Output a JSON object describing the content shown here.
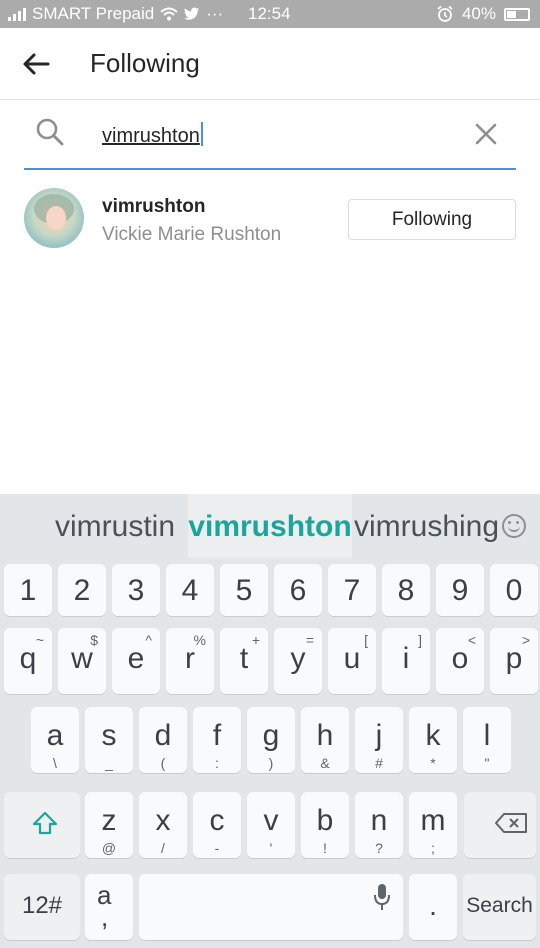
{
  "status_bar": {
    "carrier": "SMART Prepaid",
    "dots": "···",
    "time": "12:54",
    "battery": "40%"
  },
  "header": {
    "title": "Following"
  },
  "search": {
    "value": "vimrushton"
  },
  "user": {
    "username": "vimrushton",
    "full_name": "Vickie Marie Rushton",
    "button_label": "Following"
  },
  "keyboard": {
    "suggestions": [
      "vimrustin",
      "vimrushton",
      "vimrushing"
    ],
    "number_row": [
      "1",
      "2",
      "3",
      "4",
      "5",
      "6",
      "7",
      "8",
      "9",
      "0"
    ],
    "row_q": [
      {
        "k": "q",
        "s": "~"
      },
      {
        "k": "w",
        "s": "$"
      },
      {
        "k": "e",
        "s": "^"
      },
      {
        "k": "r",
        "s": "%"
      },
      {
        "k": "t",
        "s": "+"
      },
      {
        "k": "y",
        "s": "="
      },
      {
        "k": "u",
        "s": "["
      },
      {
        "k": "i",
        "s": "]"
      },
      {
        "k": "o",
        "s": "<"
      },
      {
        "k": "p",
        "s": ">"
      }
    ],
    "row_a": [
      {
        "k": "a",
        "s": "\\"
      },
      {
        "k": "s",
        "s": "_"
      },
      {
        "k": "d",
        "s": "("
      },
      {
        "k": "f",
        "s": ":"
      },
      {
        "k": "g",
        "s": ")"
      },
      {
        "k": "h",
        "s": "&"
      },
      {
        "k": "j",
        "s": "#"
      },
      {
        "k": "k",
        "s": "*"
      },
      {
        "k": "l",
        "s": "\""
      }
    ],
    "row_z": [
      {
        "k": "z",
        "s": "@"
      },
      {
        "k": "x",
        "s": "/"
      },
      {
        "k": "c",
        "s": "-"
      },
      {
        "k": "v",
        "s": "'"
      },
      {
        "k": "b",
        "s": "!"
      },
      {
        "k": "n",
        "s": "?"
      },
      {
        "k": "m",
        "s": ";"
      }
    ],
    "symbols_label": "12#",
    "a_comma_top": "a",
    "a_comma_bottom": ",",
    "period": ".",
    "search_label": "Search",
    "accent_color": "#1aa69a"
  }
}
